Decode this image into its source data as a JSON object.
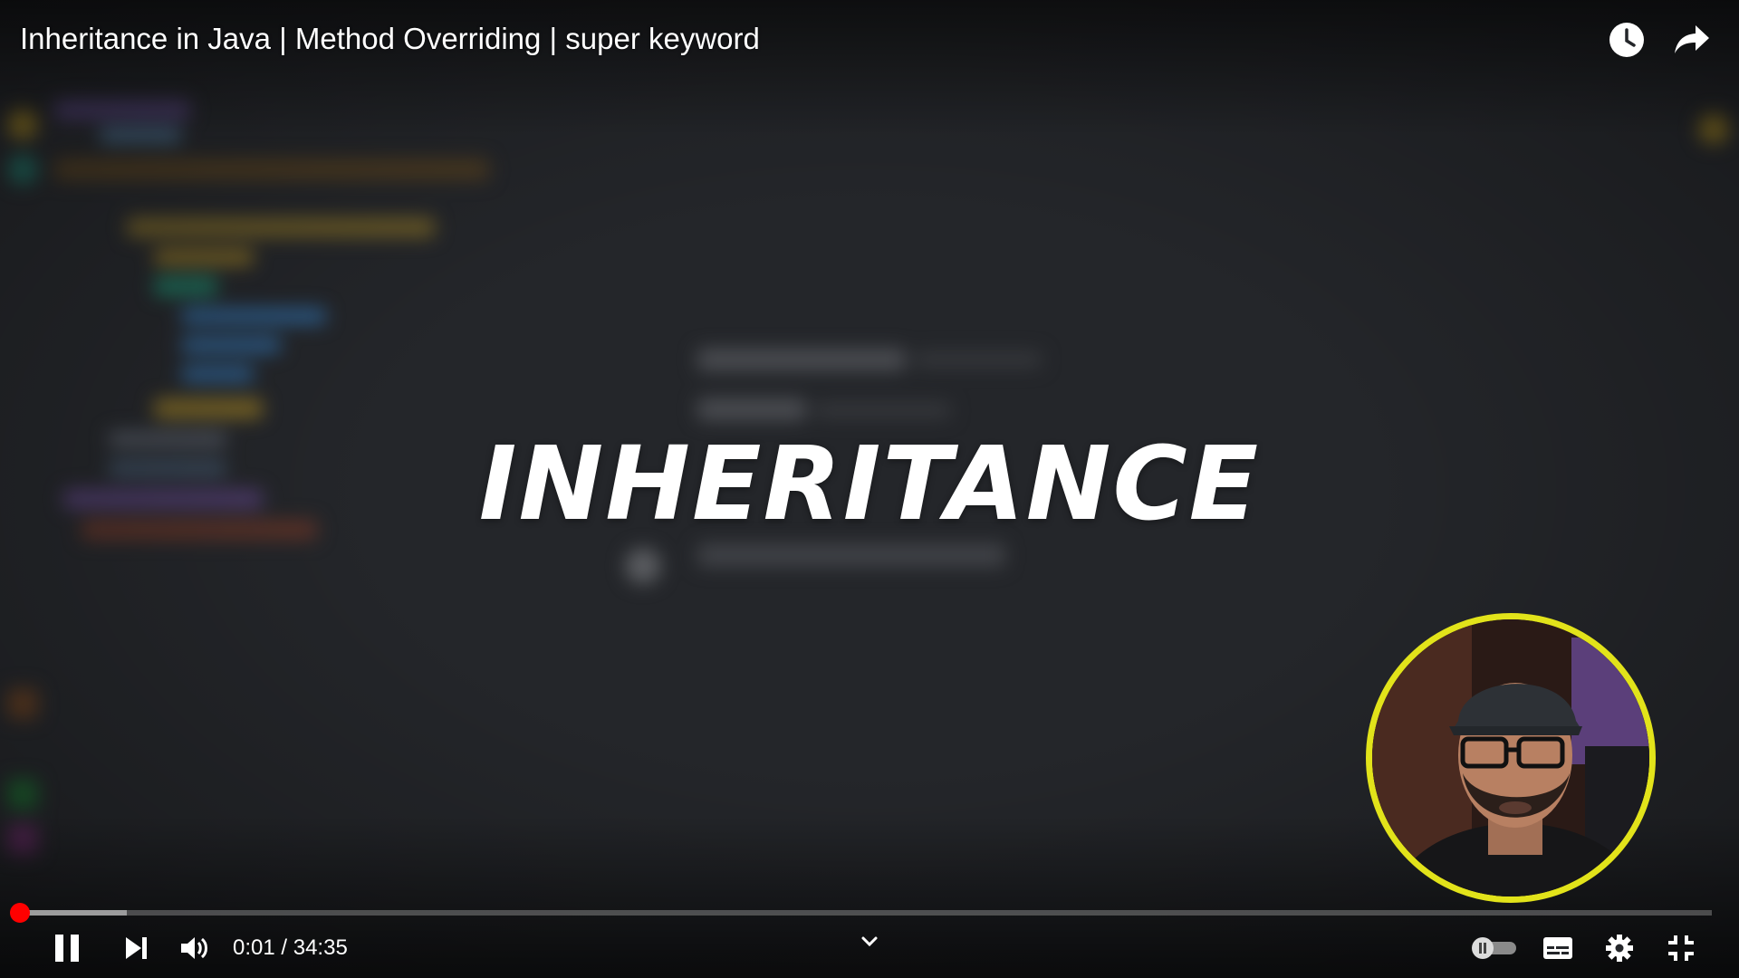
{
  "video": {
    "title": "Inheritance in Java | Method Overriding | super keyword",
    "headline": "INHERITANCE"
  },
  "top_actions": [
    {
      "name": "watch-later",
      "icon": "clock-icon"
    },
    {
      "name": "share",
      "icon": "share-arrow-icon"
    }
  ],
  "player": {
    "current_time": "0:01",
    "separator": " / ",
    "duration": "34:35",
    "played_fraction": 0.001,
    "buffered_fraction": 0.064,
    "is_playing": true,
    "autoplay": false,
    "colors": {
      "progress_played": "#ff0000",
      "webcam_border": "#e2e31a",
      "background": "#24262a"
    }
  },
  "controls": {
    "left": [
      "pause-icon",
      "next-icon",
      "volume-icon"
    ],
    "center": [
      "chevron-down-icon"
    ],
    "right": [
      "autoplay-toggle-icon",
      "subtitles-icon",
      "settings-gear-icon",
      "exit-fullscreen-icon"
    ]
  }
}
